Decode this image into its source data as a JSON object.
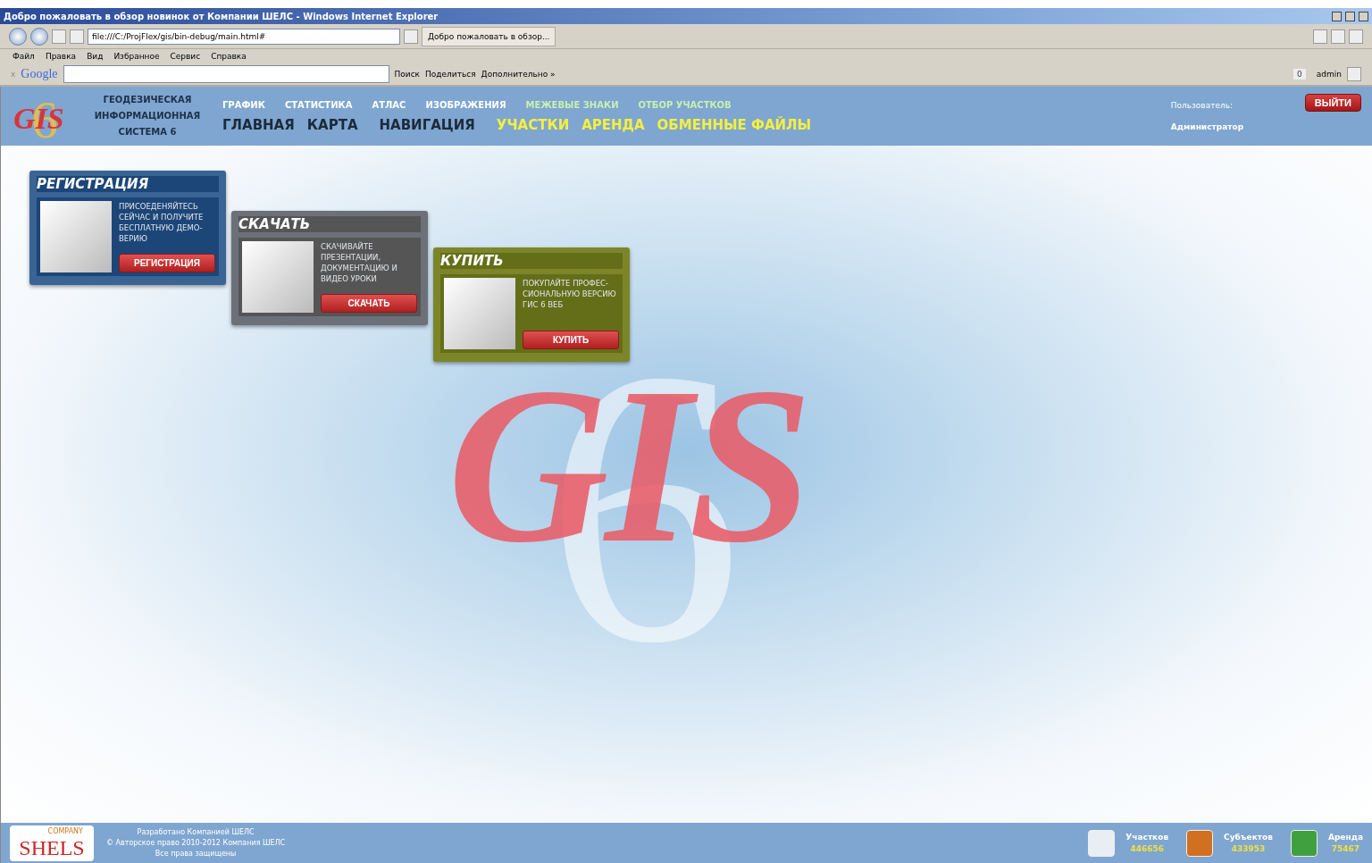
{
  "window": {
    "title": "Добро пожаловать в обзор новинок от Компании ШЕЛС - Windows Internet Explorer"
  },
  "browser": {
    "address": "file:///C:/ProjFlex/gis/bin-debug/main.html#",
    "tab": "Добро пожаловать в обзор...",
    "menu": [
      "Файл",
      "Правка",
      "Вид",
      "Избранное",
      "Сервис",
      "Справка"
    ],
    "google": {
      "close": "x",
      "logo": "Google",
      "search": "Поиск",
      "share": "Поделиться",
      "more": "Дополнительно »",
      "count": "0",
      "user": "admin"
    }
  },
  "header": {
    "logo": {
      "text": "GIS",
      "digit": "6"
    },
    "system_name": [
      "ГЕОДЕЗИЧЕСКАЯ",
      "ИНФОРМАЦИОННАЯ",
      "СИСТЕМА 6"
    ],
    "top_links": [
      {
        "label": "ГРАФИК",
        "color": "#ffffff"
      },
      {
        "label": "СТАТИСТИКА",
        "color": "#ffffff"
      },
      {
        "label": "АТЛАС",
        "color": "#ffffff"
      },
      {
        "label": "ИЗОБРАЖЕНИЯ",
        "color": "#ffffff"
      },
      {
        "label": "МЕЖЕВЫЕ ЗНАКИ",
        "color": "#c8f0b0"
      },
      {
        "label": "ОТБОР УЧАСТКОВ",
        "color": "#c8f0b0"
      }
    ],
    "main_links": [
      {
        "label": "ГЛАВНАЯ",
        "color": "#1c2a3a"
      },
      {
        "label": "КАРТА",
        "color": "#1c2a3a"
      },
      {
        "label": "НАВИГАЦИЯ",
        "color": "#1c2a3a"
      },
      {
        "label": "УЧАСТКИ",
        "color": "#f4f040"
      },
      {
        "label": "АРЕНДА",
        "color": "#f4f040"
      },
      {
        "label": "ОБМЕННЫЕ ФАЙЛЫ",
        "color": "#f4f040"
      }
    ],
    "user_label": "Пользователь:",
    "user_name": "Администратор",
    "logout": "ВЫЙТИ"
  },
  "cards": [
    {
      "kind": "register",
      "title": "РЕГИСТРАЦИЯ",
      "text": "ПРИСОЕДЕНЯЙТЕСЬ СЕЙЧАС И ПОЛУЧИТЕ БЕСПЛАТНУЮ ДЕМО-ВЕРИЮ",
      "button": "РЕГИСТРАЦИЯ"
    },
    {
      "kind": "download",
      "title": "СКАЧАТЬ",
      "text": "СКАЧИВАЙТЕ ПРЕЗЕНТАЦИИ, ДОКУМЕНТАЦИЮ И ВИДЕО УРОКИ",
      "button": "СКАЧАТЬ"
    },
    {
      "kind": "buy",
      "title": "КУПИТЬ",
      "text": "ПОКУПАЙТЕ ПРОФЕС-СИОНАЛЬНУЮ ВЕРСИЮ ГИС 6 ВЕБ",
      "button": "КУПИТЬ"
    }
  ],
  "hero": {
    "text": "GIS",
    "digit": "6"
  },
  "footer": {
    "logo": {
      "small": "COMPANY",
      "text": "SHELS"
    },
    "lines": [
      "Разработано Компанией ШЕЛС",
      "© Авторское право 2010-2012 Компания ШЕЛС",
      "Все права защищены"
    ],
    "stats": [
      {
        "kind": "plots",
        "label": "Участков",
        "value": "446656"
      },
      {
        "kind": "subjects",
        "label": "Субъектов",
        "value": "433953"
      },
      {
        "kind": "rent",
        "label": "Аренда",
        "value": "75467"
      }
    ]
  }
}
